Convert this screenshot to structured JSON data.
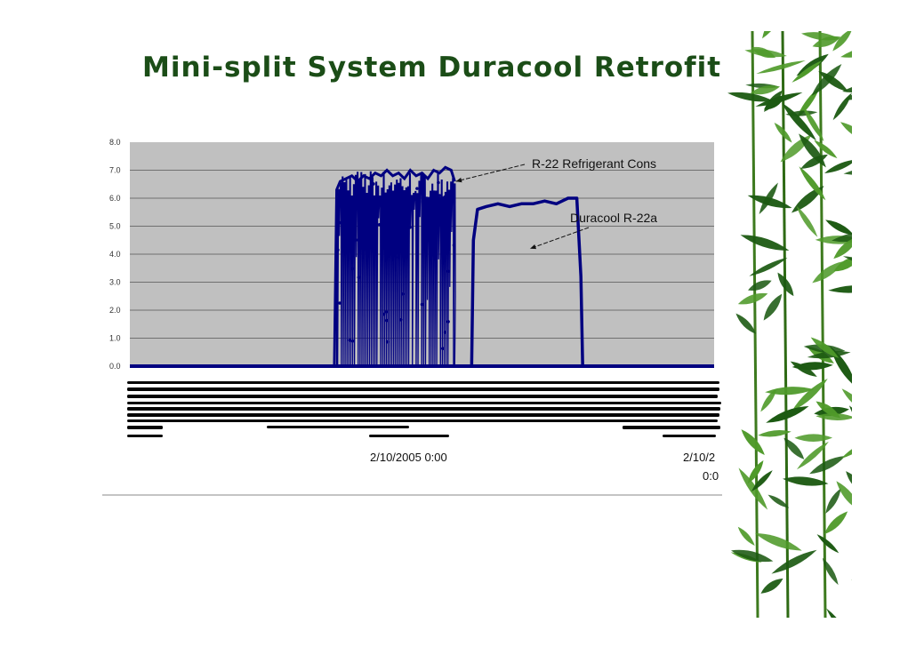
{
  "slide": {
    "title": "Mini-split System Duracool Retrofit"
  },
  "colors": {
    "title": "#1b4d17",
    "plot_bg": "#c0c0c0",
    "series": "#000080",
    "leaf_dark": "#1c5a12",
    "leaf_light": "#4f9a2a"
  },
  "chart_data": {
    "type": "line",
    "yticks": [
      "8.0",
      "7.0",
      "6.0",
      "5.0",
      "4.0",
      "3.0",
      "2.0",
      "1.0",
      "0.0"
    ],
    "ylim": [
      0,
      8
    ],
    "xlim": [
      0,
      100
    ],
    "grid": true,
    "date_labels": [
      {
        "text": "2/10/2005 0:00",
        "x": 52
      },
      {
        "text": "2/10/2",
        "x": 100
      },
      {
        "text": "0:0",
        "x": 100
      }
    ],
    "series": [
      {
        "name": "R-22 Refrigerant Cons",
        "x": [
          0,
          35,
          35.4,
          36,
          37,
          38,
          39,
          40,
          41,
          42,
          43,
          44,
          45,
          46,
          47,
          48,
          49,
          50,
          51,
          52,
          53,
          54,
          55,
          55.6
        ],
        "y": [
          0,
          0,
          6.3,
          6.6,
          6.7,
          6.8,
          6.6,
          6.8,
          6.7,
          6.9,
          6.8,
          7.0,
          6.8,
          6.9,
          6.7,
          7.0,
          6.8,
          6.9,
          6.7,
          7.0,
          6.9,
          7.1,
          7.0,
          6.6
        ],
        "cycling": {
          "x_start": 35.4,
          "x_end": 55.6,
          "low": 0,
          "high": 7.0
        }
      },
      {
        "name": "Duracool R-22a",
        "x": [
          56,
          58.5,
          58.8,
          59.5,
          61,
          63,
          65,
          67,
          69,
          71,
          73,
          75,
          76.5,
          77.2,
          77.5,
          100
        ],
        "y": [
          0,
          0,
          4.5,
          5.6,
          5.7,
          5.8,
          5.7,
          5.8,
          5.8,
          5.9,
          5.8,
          6.0,
          6.0,
          3.2,
          0,
          0
        ]
      }
    ],
    "annotations": [
      {
        "text": "R-22 Refrigerant Cons",
        "target_x": 55.8,
        "target_y": 6.6
      },
      {
        "text": "Duracool R-22a",
        "target_x": 68.5,
        "target_y": 4.2
      }
    ]
  }
}
